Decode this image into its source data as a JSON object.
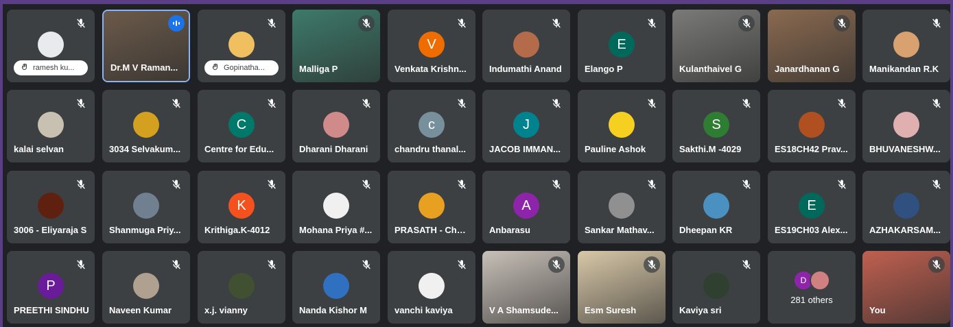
{
  "tiles": [
    {
      "name": "ramesh ku...",
      "avatar": "photo",
      "avatar_color": "#e8eaed",
      "pill": true
    },
    {
      "name": "Dr.M V Raman...",
      "video": true,
      "speaking": true,
      "bg": "#6b5a4a"
    },
    {
      "name": "Gopinatha...",
      "avatar": "photo",
      "avatar_color": "#f0c060",
      "pill": true
    },
    {
      "name": "Malliga P",
      "video": true,
      "bg": "#3d7a6a"
    },
    {
      "name": "Venkata Krishn...",
      "avatar": "V",
      "avatar_color": "#ef6c00"
    },
    {
      "name": "Indumathi Anand",
      "avatar": "photo",
      "avatar_color": "#b36b4a"
    },
    {
      "name": "Elango P",
      "avatar": "E",
      "avatar_color": "#00695c"
    },
    {
      "name": "Kulanthaivel G",
      "video": true,
      "bg": "#7a7a78"
    },
    {
      "name": "Janardhanan G",
      "video": true,
      "bg": "#8a6a50"
    },
    {
      "name": "Manikandan R.K",
      "avatar": "photo",
      "avatar_color": "#d9a070"
    },
    {
      "name": "kalai selvan",
      "avatar": "photo",
      "avatar_color": "#c8c0b0"
    },
    {
      "name": "3034 Selvakum...",
      "avatar": "photo",
      "avatar_color": "#d4a020"
    },
    {
      "name": "Centre for Edu...",
      "avatar": "C",
      "avatar_color": "#00796b"
    },
    {
      "name": "Dharani Dharani",
      "avatar": "photo",
      "avatar_color": "#d08a8a"
    },
    {
      "name": "chandru thanal...",
      "avatar": "c",
      "avatar_color": "#78909c"
    },
    {
      "name": "JACOB IMMAN...",
      "avatar": "J",
      "avatar_color": "#00838f"
    },
    {
      "name": "Pauline Ashok",
      "avatar": "photo",
      "avatar_color": "#f5d020"
    },
    {
      "name": "Sakthi.M -4029",
      "avatar": "S",
      "avatar_color": "#2e7d32"
    },
    {
      "name": "ES18CH42 Prav...",
      "avatar": "photo",
      "avatar_color": "#b05020"
    },
    {
      "name": "BHUVANESHW...",
      "avatar": "photo",
      "avatar_color": "#e0b0b0"
    },
    {
      "name": "3006 - Eliyaraja S",
      "avatar": "photo",
      "avatar_color": "#602010"
    },
    {
      "name": "Shanmuga Priy...",
      "avatar": "photo",
      "avatar_color": "#708090"
    },
    {
      "name": "Krithiga.K-4012",
      "avatar": "K",
      "avatar_color": "#f4511e"
    },
    {
      "name": "Mohana Priya #...",
      "avatar": "photo",
      "avatar_color": "#f0f0f0"
    },
    {
      "name": "PRASATH - ChE...",
      "avatar": "photo",
      "avatar_color": "#e8a020"
    },
    {
      "name": "Anbarasu",
      "avatar": "A",
      "avatar_color": "#8e24aa"
    },
    {
      "name": "Sankar Mathav...",
      "avatar": "photo",
      "avatar_color": "#909090"
    },
    {
      "name": "Dheepan KR",
      "avatar": "photo",
      "avatar_color": "#4a90c0"
    },
    {
      "name": "ES19CH03 Alex...",
      "avatar": "E",
      "avatar_color": "#00695c"
    },
    {
      "name": "AZHAKARSAM...",
      "avatar": "photo",
      "avatar_color": "#305080"
    },
    {
      "name": "PREETHI SINDHU",
      "avatar": "P",
      "avatar_color": "#6a1b9a"
    },
    {
      "name": "Naveen Kumar",
      "avatar": "photo",
      "avatar_color": "#b0a090"
    },
    {
      "name": "x.j. vianny",
      "avatar": "photo",
      "avatar_color": "#405030"
    },
    {
      "name": "Nanda Kishor M",
      "avatar": "photo",
      "avatar_color": "#3070c0"
    },
    {
      "name": "vanchi kaviya",
      "avatar": "photo",
      "avatar_color": "#f0f0f0"
    },
    {
      "name": "V A Shamsude...",
      "video": true,
      "bg": "#c8c0b8"
    },
    {
      "name": "Esm Suresh",
      "video": true,
      "bg": "#d8c8a8"
    },
    {
      "name": "Kaviya sri",
      "avatar": "photo",
      "avatar_color": "#304030"
    },
    {
      "others": true,
      "text": "281 others",
      "initial": "D",
      "initial_color": "#8e24aa",
      "second_color": "#d08080"
    },
    {
      "name": "You",
      "video": true,
      "bg": "#c06050"
    }
  ]
}
